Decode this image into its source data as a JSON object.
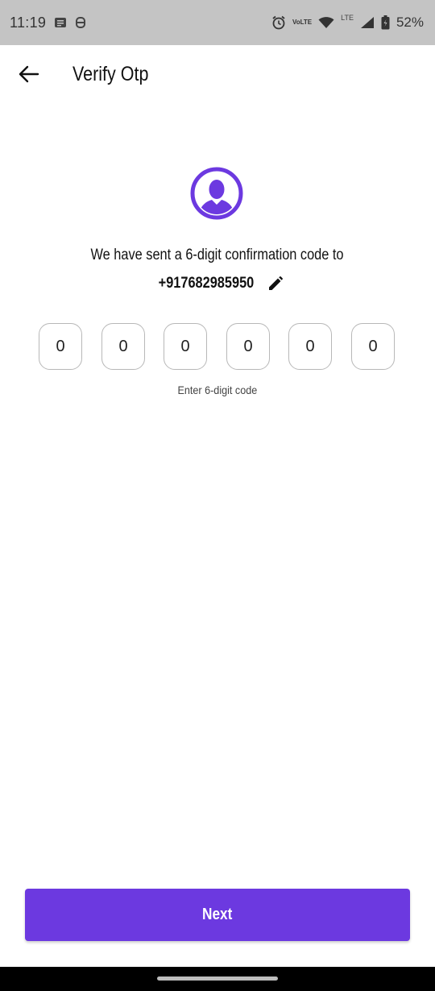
{
  "status_bar": {
    "time": "11:19",
    "battery": "52%",
    "volte_label_top": "Vo",
    "volte_label_bottom": "LTE",
    "lte_label": "LTE",
    "icons": [
      "notification-icon",
      "vpn-icon",
      "alarm-icon",
      "volte-icon",
      "wifi-icon",
      "signal-icon",
      "battery-icon"
    ]
  },
  "app_bar": {
    "title": "Verify Otp",
    "back_icon": "arrow-left-icon"
  },
  "verify": {
    "message": "We have sent a 6-digit confirmation code to",
    "phone": "+917682985950",
    "edit_icon": "pencil-icon",
    "otp_digits": [
      "0",
      "0",
      "0",
      "0",
      "0",
      "0"
    ],
    "hint": "Enter 6-digit code"
  },
  "actions": {
    "next_label": "Next"
  },
  "colors": {
    "accent": "#6c39e0",
    "status_bar_bg": "#c4c4c4"
  }
}
